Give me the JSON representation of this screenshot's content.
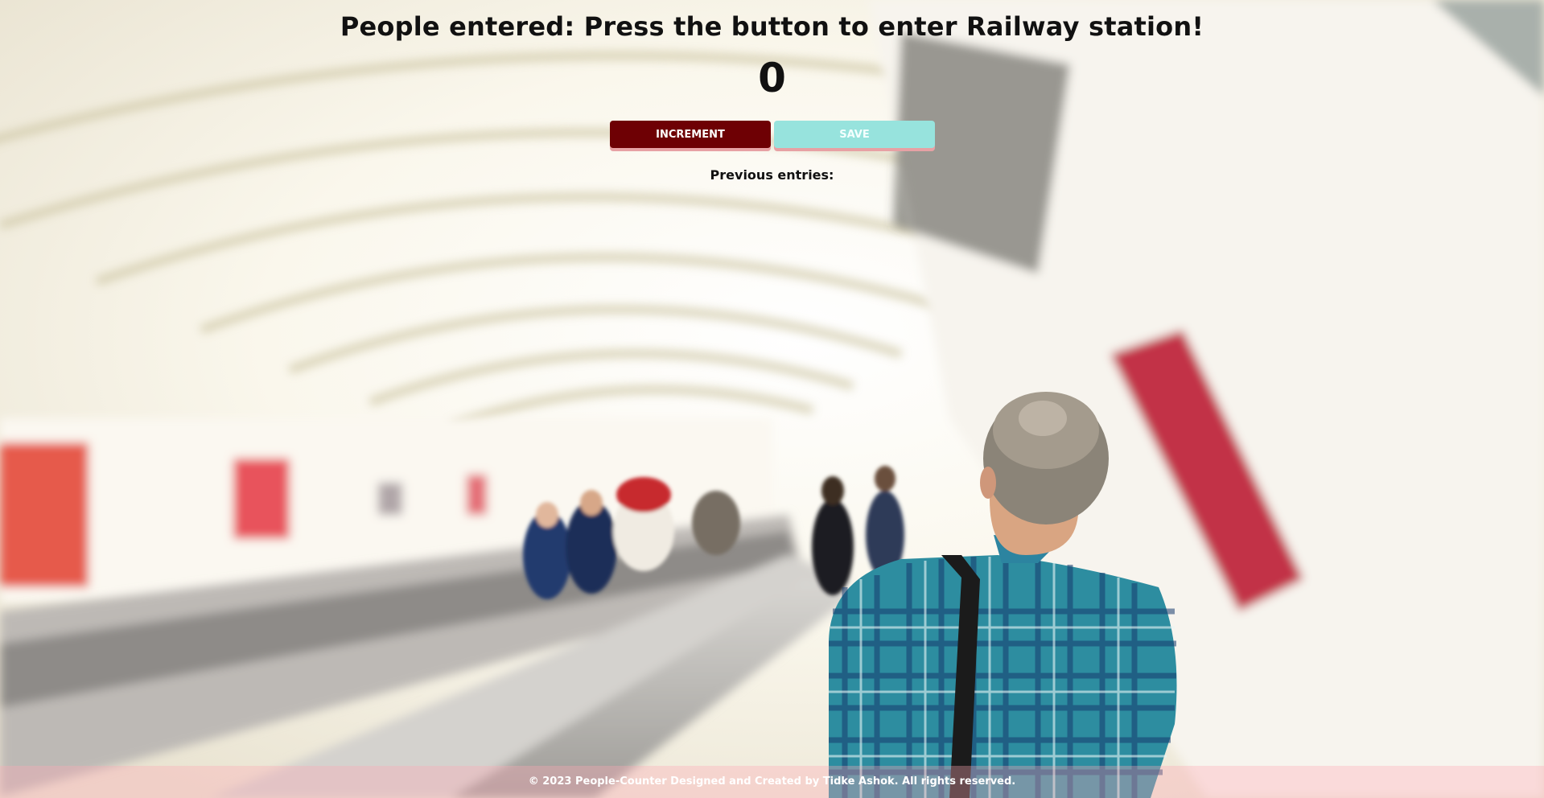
{
  "header": {
    "title": "People entered: Press the button to enter Railway station!"
  },
  "counter": {
    "value": "0"
  },
  "actions": {
    "increment_label": "INCREMENT",
    "save_label": "SAVE"
  },
  "entries": {
    "label": "Previous entries:"
  },
  "footer": {
    "text": "© 2023 People-Counter Designed and Created by Tidke Ashok. All rights reserved."
  },
  "colors": {
    "increment_bg": "#6e0004",
    "save_bg": "#97e3dd",
    "button_shadow": "#e7a1a4"
  },
  "background": {
    "scene": "railway-escalator-photo"
  }
}
